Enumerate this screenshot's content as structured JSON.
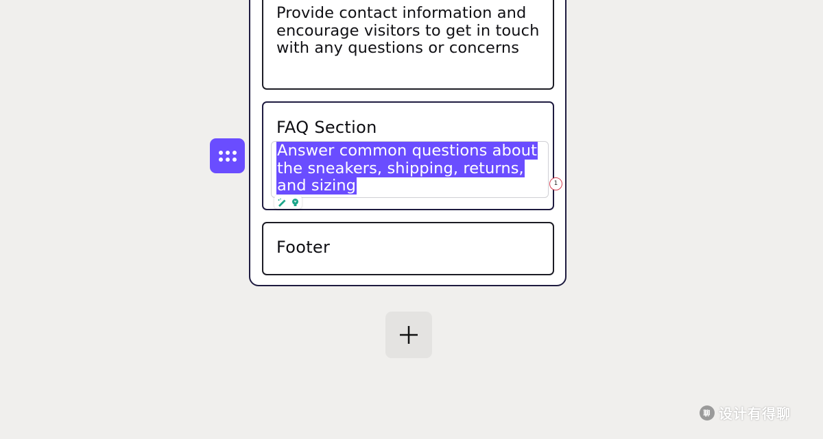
{
  "sections": {
    "contact": {
      "description": "Provide contact information and encourage visitors to get in touch with any questions or concerns"
    },
    "faq": {
      "title": "FAQ Section",
      "description_line1": "Answer common questions about",
      "description_line2": "the sneakers, shipping, returns,",
      "description_line3": "and sizing"
    },
    "footer": {
      "title": "Footer"
    }
  },
  "comment_badge": {
    "count": "1"
  },
  "toolbar": {
    "tools": [
      "magic-pen-icon",
      "lightbulb-icon"
    ]
  },
  "icons": {
    "drag_handle": "drag-dots-icon",
    "add": "plus-icon"
  },
  "watermark": {
    "text": "设计有得聊",
    "logo_text": "聊"
  },
  "colors": {
    "accent": "#6a4dff",
    "background": "#f0efed",
    "board_border": "#1d1a3f",
    "badge_border": "#d43c4f",
    "tool_green": "#1aa58a"
  }
}
